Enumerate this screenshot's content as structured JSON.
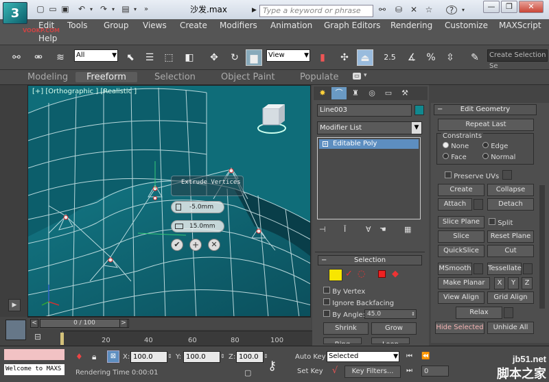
{
  "app": {
    "logo_text": "3",
    "doc_title": "沙发.max",
    "search_placeholder": "Type a keyword or phrase",
    "watermark_small": "VOOKP.COM"
  },
  "menu": [
    "Edit",
    "Tools",
    "Group",
    "Views",
    "Create",
    "Modifiers",
    "Animation",
    "Graph Editors",
    "Rendering",
    "Customize",
    "MAXScript",
    "Help"
  ],
  "toolbar": {
    "selection_filter": "All",
    "ref_coord": "View",
    "snap_angle": "2.5",
    "snap_percent": "%",
    "named_selection_placeholder": "Create Selection Se"
  },
  "ribbon_tabs": [
    "Modeling",
    "Freeform",
    "Selection",
    "Object Paint",
    "Populate"
  ],
  "viewport": {
    "label": "[+] [Orthographic ] [Realistic ]",
    "caddy_title": "Extrude Vertices",
    "height_value": "-5.0mm",
    "width_value": "15.0mm"
  },
  "command_panel": {
    "object_name": "Line003",
    "modifier_list": "Modifier List",
    "stack_item": "Editable Poly",
    "selection_title": "Selection",
    "by_vertex": "By Vertex",
    "ignore_backfacing": "Ignore Backfacing",
    "by_angle": "By Angle:",
    "by_angle_value": "45.0",
    "shrink": "Shrink",
    "grow": "Grow",
    "ring": "Ring",
    "loop": "Loop"
  },
  "edit_geometry": {
    "title": "Edit Geometry",
    "repeat_last": "Repeat Last",
    "constraints": "Constraints",
    "none": "None",
    "edge": "Edge",
    "face": "Face",
    "normal": "Normal",
    "preserve_uvs": "Preserve UVs",
    "create": "Create",
    "collapse": "Collapse",
    "attach": "Attach",
    "detach": "Detach",
    "slice_plane": "Slice Plane",
    "split": "Split",
    "slice": "Slice",
    "reset_plane": "Reset Plane",
    "quickslice": "QuickSlice",
    "cut": "Cut",
    "msmooth": "MSmooth",
    "tessellate": "Tessellate",
    "make_planar": "Make Planar",
    "x": "X",
    "y": "Y",
    "z": "Z",
    "view_align": "View Align",
    "grid_align": "Grid Align",
    "relax": "Relax",
    "hide_selected": "Hide Selected",
    "unhide_all": "Unhide All"
  },
  "timeline": {
    "frame": "0 / 100",
    "ticks": [
      "20",
      "40",
      "60",
      "80",
      "100"
    ]
  },
  "status": {
    "maxscript": "Welcome to MAXS",
    "x_label": "X:",
    "x_value": "100.0",
    "y_label": "Y:",
    "y_value": "100.0",
    "z_label": "Z:",
    "z_value": "100.0",
    "auto_key": "Auto Key",
    "set_key": "Set Key",
    "selected": "Selected",
    "key_filters": "Key Filters...",
    "rendering_time": "Rendering Time  0:00:01",
    "frame_field": "0"
  },
  "watermark": {
    "site": "jb51.net",
    "brand": "脚本之家"
  }
}
